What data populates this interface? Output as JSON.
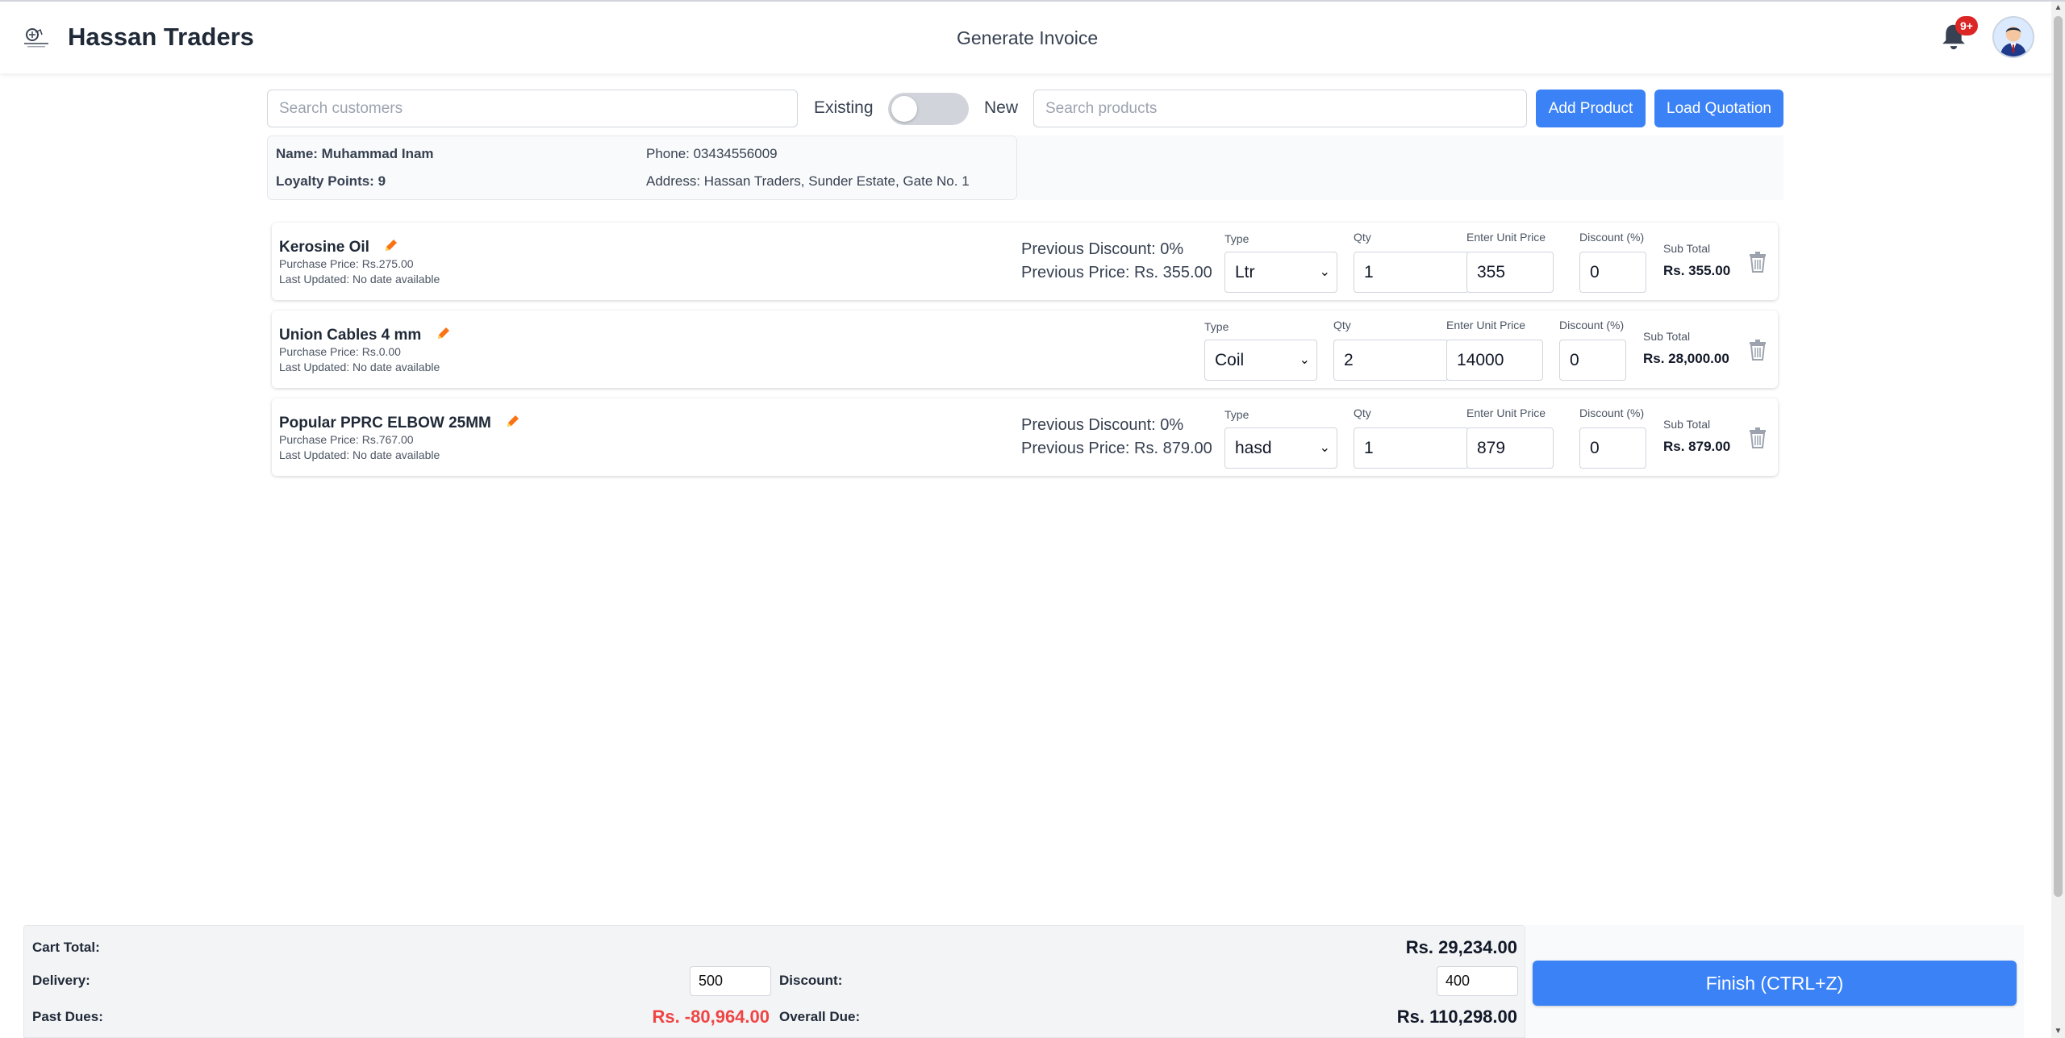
{
  "header": {
    "brand": "Hassan Traders",
    "title": "Generate Invoice",
    "notifications_badge": "9+"
  },
  "controls": {
    "customer_search_placeholder": "Search customers",
    "toggle_existing": "Existing",
    "toggle_new": "New",
    "toggle_on": false,
    "product_search_placeholder": "Search products",
    "add_product": "Add Product",
    "load_quotation": "Load Quotation"
  },
  "customer": {
    "name": "Name: Muhammad Inam",
    "loyalty": "Loyalty Points: 9",
    "phone": "Phone: 03434556009",
    "address": "Address: Hassan Traders, Sunder Estate, Gate No. 1"
  },
  "labels": {
    "type": "Type",
    "qty": "Qty",
    "unit_price": "Enter Unit Price",
    "discount": "Discount (%)",
    "sub_total": "Sub Total"
  },
  "items": [
    {
      "name": "Kerosine Oil",
      "purchase_price": "Purchase Price: Rs.275.00",
      "last_updated": "Last Updated: No date available",
      "prev_discount": "Previous Discount: 0%",
      "prev_price": "Previous Price: Rs. 355.00",
      "type": "Ltr",
      "qty": "1",
      "unit_price": "355",
      "discount": "0",
      "sub_total": "Rs. 355.00"
    },
    {
      "name": "Union Cables 4 mm",
      "purchase_price": "Purchase Price: Rs.0.00",
      "last_updated": "Last Updated: No date available",
      "prev_discount": "",
      "prev_price": "",
      "type": "Coil",
      "qty": "2",
      "unit_price": "14000",
      "discount": "0",
      "sub_total": "Rs. 28,000.00"
    },
    {
      "name": "Popular PPRC ELBOW 25MM",
      "purchase_price": "Purchase Price: Rs.767.00",
      "last_updated": "Last Updated: No date available",
      "prev_discount": "Previous Discount: 0%",
      "prev_price": "Previous Price: Rs. 879.00",
      "type": "hasd",
      "qty": "1",
      "unit_price": "879",
      "discount": "0",
      "sub_total": "Rs. 879.00"
    }
  ],
  "footer": {
    "cart_total_label": "Cart Total:",
    "cart_total": "Rs. 29,234.00",
    "delivery_label": "Delivery:",
    "delivery": "500",
    "discount_label": "Discount:",
    "discount": "400",
    "past_dues_label": "Past Dues:",
    "past_dues": "Rs. -80,964.00",
    "overall_due_label": "Overall Due:",
    "overall_due": "Rs. 110,298.00",
    "finish": "Finish (CTRL+Z)"
  },
  "colors": {
    "accent": "#3b82f6",
    "danger": "#ef4444",
    "pencil": "#f97316"
  }
}
